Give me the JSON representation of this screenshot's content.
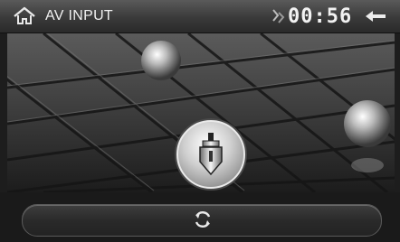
{
  "header": {
    "title": "AV INPUT",
    "clock": "00:56",
    "home_icon": "home-icon",
    "clock_icon": "clock-icon",
    "back_icon": "back-arrow-icon"
  },
  "main": {
    "center_icon": "av-input-plug-icon"
  },
  "bottom": {
    "refresh_icon": "refresh-icon"
  }
}
